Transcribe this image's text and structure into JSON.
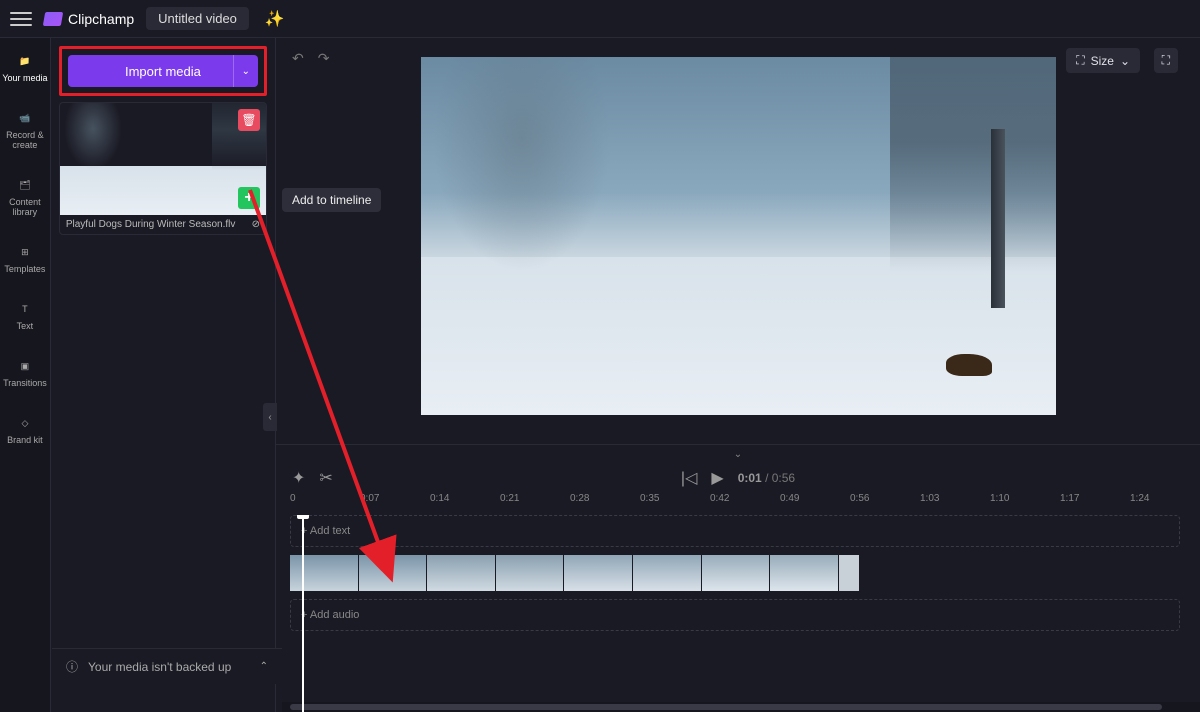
{
  "app": {
    "name": "Clipchamp",
    "title": "Untitled video"
  },
  "sidebar": {
    "items": [
      {
        "label": "Your media"
      },
      {
        "label": "Record & create"
      },
      {
        "label": "Content library"
      },
      {
        "label": "Templates"
      },
      {
        "label": "Text"
      },
      {
        "label": "Transitions"
      },
      {
        "label": "Brand kit"
      }
    ]
  },
  "panel": {
    "import_label": "Import media",
    "media": {
      "name": "Playful Dogs During Winter Season.flv"
    },
    "tooltip": "Add to timeline"
  },
  "preview": {
    "size_label": "Size"
  },
  "timeline": {
    "current": "0:01",
    "duration": "/ 0:56",
    "ruler": [
      "0",
      "0:07",
      "0:14",
      "0:21",
      "0:28",
      "0:35",
      "0:42",
      "0:49",
      "0:56",
      "1:03",
      "1:10",
      "1:17",
      "1:24"
    ],
    "add_text": "+ Add text",
    "add_audio": "+ Add audio"
  },
  "footer": {
    "msg": "Your media isn't backed up"
  }
}
